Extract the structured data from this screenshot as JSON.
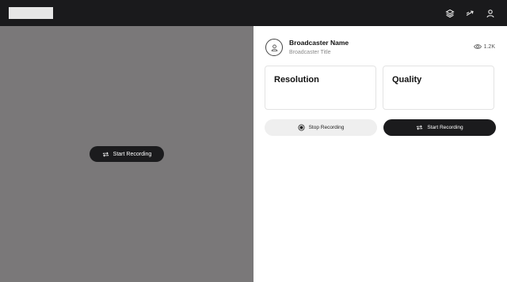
{
  "topbar": {
    "icons": [
      "layers-icon",
      "share-icon",
      "user-icon"
    ]
  },
  "video": {
    "start_label": "Start Recording"
  },
  "broadcaster": {
    "name": "Broadcaster Name",
    "title": "Broadcaster Title",
    "views": "1.2K"
  },
  "cards": {
    "resolution_label": "Resolution",
    "quality_label": "Quality"
  },
  "controls": {
    "stop_label": "Stop Recording",
    "start_label": "Start Recording"
  },
  "colors": {
    "topbar": "#1a1a1c",
    "video_bg": "#7a7879",
    "dark_button": "#1b1b1d",
    "light_button": "#efefef"
  }
}
